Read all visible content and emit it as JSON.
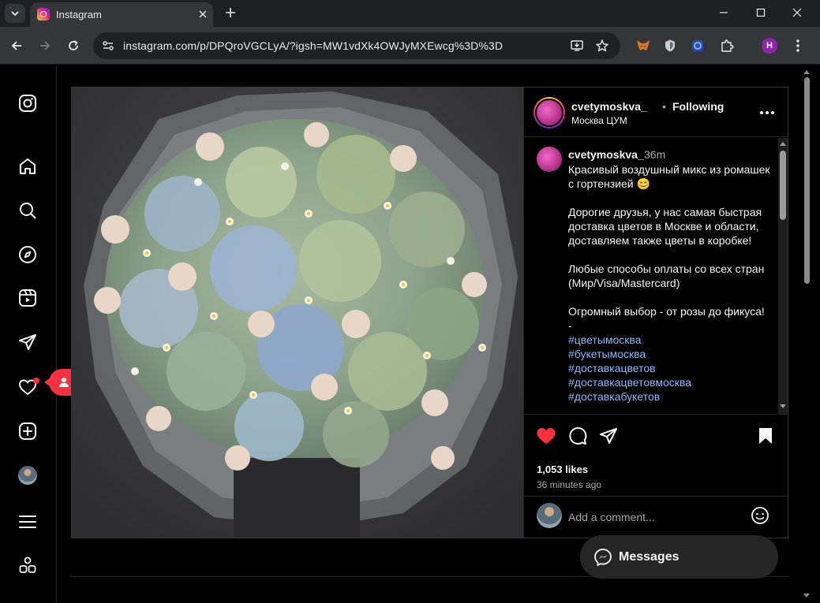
{
  "browser": {
    "tab_title": "Instagram",
    "url": "instagram.com/p/DPQroVGCLyA/?igsh=MW1vdXk4OWJyMXEwcg%3D%3D",
    "profile_initial": "H"
  },
  "sidebar": {
    "notification_badge_count": "1"
  },
  "post": {
    "username": "cvetymoskva_",
    "separator": "•",
    "follow_status": "Following",
    "location": "Москва ЦУМ",
    "caption_time": "36m",
    "caption_paragraphs": [
      "Красивый воздушный микс из ромашек с гортензией 😊",
      "Дорогие друзья, у нас самая быстрая доставка цветов в Москве и области, доставляем также цветы в коробке!",
      "Любые способы оплаты со всех стран (Мир/Visa/Mastercard)",
      "Огромный выбор - от розы до фикуса!\n-"
    ],
    "hashtags": [
      "#цветымосква",
      "#букетымосква",
      "#доставкацветов",
      "#доставкацветовмосква",
      "#доставкабукетов"
    ],
    "likes": "1,053 likes",
    "time_ago": "36 minutes ago",
    "comment_placeholder": "Add a comment..."
  },
  "messages": {
    "label": "Messages"
  },
  "colors": {
    "background": "#000000",
    "like_red": "#ff3040",
    "hashtag_blue": "#8fb8ff",
    "border": "#262626"
  }
}
